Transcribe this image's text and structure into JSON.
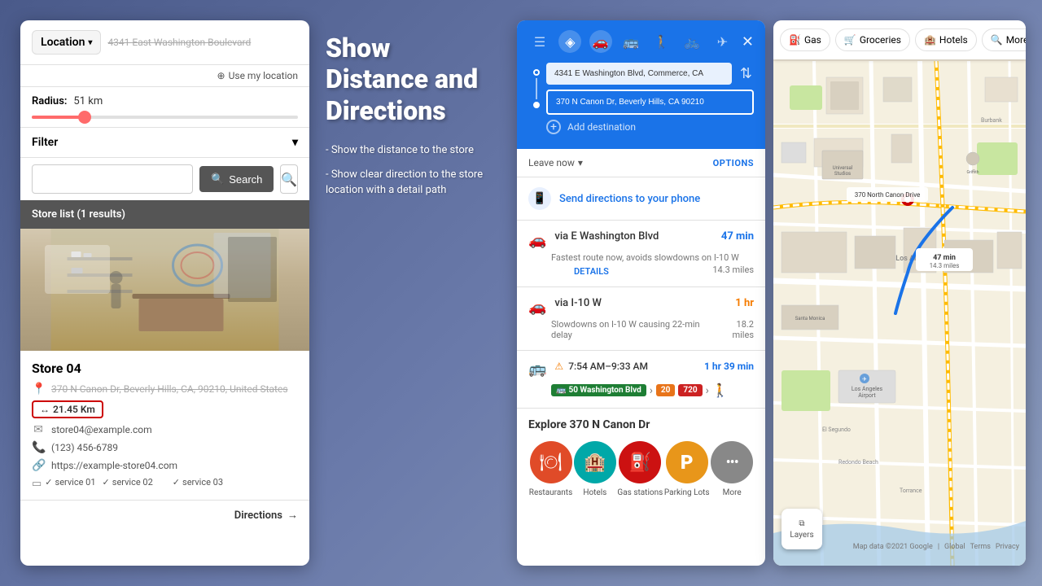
{
  "leftPanel": {
    "title": "Location",
    "address": "4341 East Washington Boulevard",
    "useLocation": "Use my location",
    "radius": {
      "label": "Radius:",
      "value": "51 km",
      "sliderPercent": 20
    },
    "filter": {
      "label": "Filter"
    },
    "search": {
      "placeholder": "",
      "buttonLabel": "Search"
    },
    "storeList": {
      "header": "Store list (1 results)"
    },
    "store": {
      "name": "Store 04",
      "address": "370 N Canon Dr, Beverly Hills, CA, 90210, United States",
      "distance": "21.45 Km",
      "email": "store04@example.com",
      "phone": "(123) 456-6789",
      "website": "https://example-store04.com",
      "services": [
        "service 01",
        "service 02",
        "service 03"
      ]
    },
    "directionsBtn": "Directions"
  },
  "centerPanel": {
    "heading": "Show Distance and Directions",
    "bullet1": "- Show the distance to the store",
    "bullet2": "- Show clear direction to the store location with a detail path"
  },
  "directionsPanel": {
    "tabs": [
      {
        "icon": "☰",
        "label": "menu-icon"
      },
      {
        "icon": "◈",
        "label": "directions-icon"
      },
      {
        "icon": "🚗",
        "label": "car-icon"
      },
      {
        "icon": "🚌",
        "label": "transit-icon"
      },
      {
        "icon": "🚶",
        "label": "walk-icon"
      },
      {
        "icon": "🚲",
        "label": "bike-icon"
      },
      {
        "icon": "✈",
        "label": "flight-icon"
      }
    ],
    "from": "4341 E Washington Blvd, Commerce, CA",
    "to": "370 N Canon Dr, Beverly Hills, CA 90210",
    "addDestination": "Add destination",
    "leaveNow": "Leave now",
    "options": "OPTIONS",
    "sendDirections": "Send directions to your phone",
    "routes": [
      {
        "via": "via E Washington Blvd",
        "time": "47 min",
        "distance": "14.3 miles",
        "desc": "Fastest route now, avoids slowdowns on I-10 W",
        "details": "DETAILS",
        "type": "car",
        "status": "fastest"
      },
      {
        "via": "via I-10 W",
        "time": "1 hr",
        "distance": "18.2 miles",
        "desc": "Slowdowns on I-10 W causing 22-min delay",
        "type": "car",
        "status": "slow"
      }
    ],
    "transit": {
      "timeRange": "7:54 AM–9:33 AM",
      "duration": "1 hr 39 min",
      "warning": true,
      "badges": [
        {
          "label": "50 Washington Blvd",
          "color": "green"
        },
        {
          "label": "20",
          "color": "orange"
        },
        {
          "label": "720",
          "color": "red"
        }
      ]
    },
    "explore": {
      "title": "Explore 370 N Canon Dr",
      "items": [
        {
          "label": "Restaurants",
          "color": "#e04b28",
          "icon": "🍽"
        },
        {
          "label": "Hotels",
          "color": "#00a8a8",
          "icon": "🏨"
        },
        {
          "label": "Gas stations",
          "color": "#cc1111",
          "icon": "⛽"
        },
        {
          "label": "Parking Lots",
          "color": "#e8961a",
          "icon": "P"
        },
        {
          "label": "More",
          "color": "#888",
          "icon": "···"
        }
      ]
    }
  },
  "mapPanel": {
    "chips": [
      {
        "label": "Gas",
        "icon": "⛽",
        "active": false
      },
      {
        "label": "Groceries",
        "icon": "🛒",
        "active": false
      },
      {
        "label": "Hotels",
        "icon": "🏨",
        "active": false
      }
    ],
    "more": "More",
    "routeLabel1": "47 min",
    "routeLabel2": "14.3 miles",
    "destination": "370 North Canon Drive",
    "layers": "Layers",
    "googleLogo": "Google",
    "mapData": "Map data ©2021 Google",
    "footer": [
      "Global",
      "Terms",
      "Privacy"
    ]
  }
}
